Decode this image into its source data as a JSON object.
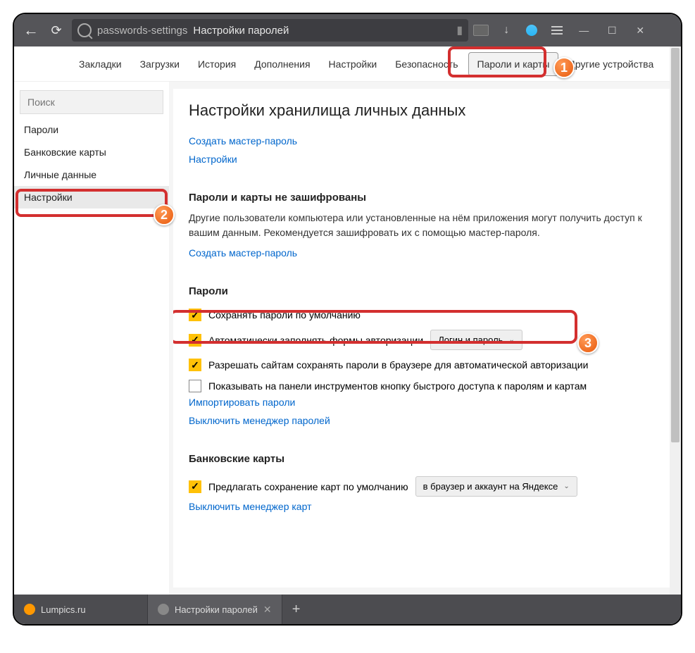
{
  "address": {
    "url": "passwords-settings",
    "title": "Настройки паролей"
  },
  "topnav": {
    "items": [
      "Закладки",
      "Загрузки",
      "История",
      "Дополнения",
      "Настройки",
      "Безопасность",
      "Пароли и карты",
      "Другие устройства"
    ]
  },
  "sidebar": {
    "search_placeholder": "Поиск",
    "items": [
      "Пароли",
      "Банковские карты",
      "Личные данные",
      "Настройки"
    ]
  },
  "content": {
    "page_title": "Настройки хранилища личных данных",
    "link_master": "Создать мастер-пароль",
    "link_settings": "Настройки",
    "warn_head": "Пароли и карты не зашифрованы",
    "warn_body": "Другие пользователи компьютера или установленные на нём приложения могут получить доступ к вашим данным. Рекомендуется зашифровать их с помощью мастер-пароля.",
    "link_master2": "Создать мастер-пароль",
    "sec_passwords": "Пароли",
    "chk1": "Сохранять пароли по умолчанию",
    "chk2": "Автоматически заполнять формы авторизации",
    "dd2": "Логин и пароль",
    "chk3": "Разрешать сайтам сохранять пароли в браузере для автоматической авторизации",
    "chk4": "Показывать на панели инструментов кнопку быстрого доступа к паролям и картам",
    "link_import": "Импортировать пароли",
    "link_disable_pw": "Выключить менеджер паролей",
    "sec_cards": "Банковские карты",
    "chk5": "Предлагать сохранение карт по умолчанию",
    "dd5": "в браузер и аккаунт на Яндексе",
    "link_disable_cards": "Выключить менеджер карт"
  },
  "tabs": {
    "t1": "Lumpics.ru",
    "t2": "Настройки паролей"
  },
  "badges": {
    "b1": "1",
    "b2": "2",
    "b3": "3"
  }
}
